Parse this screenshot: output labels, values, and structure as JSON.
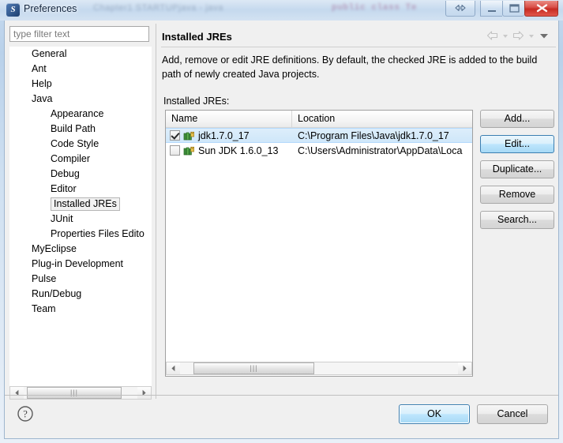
{
  "window": {
    "title": "Preferences",
    "app_icon": "eclipse-icon",
    "ghost_text_left": "Chapter1  STARTUPjava  -  java",
    "ghost_text_right": "public class  Te",
    "controls": {
      "resize": "resize-restore",
      "minimize": "minimize",
      "maximize": "maximize",
      "close": "close"
    }
  },
  "sidebar": {
    "filter": {
      "placeholder": "type filter text",
      "value": ""
    },
    "items": [
      {
        "label": "General",
        "level": 1,
        "selected": false
      },
      {
        "label": "Ant",
        "level": 1,
        "selected": false
      },
      {
        "label": "Help",
        "level": 1,
        "selected": false
      },
      {
        "label": "Java",
        "level": 1,
        "selected": false
      },
      {
        "label": "Appearance",
        "level": 2,
        "selected": false
      },
      {
        "label": "Build Path",
        "level": 2,
        "selected": false
      },
      {
        "label": "Code Style",
        "level": 2,
        "selected": false
      },
      {
        "label": "Compiler",
        "level": 2,
        "selected": false
      },
      {
        "label": "Debug",
        "level": 2,
        "selected": false
      },
      {
        "label": "Editor",
        "level": 2,
        "selected": false
      },
      {
        "label": "Installed JREs",
        "level": 2,
        "selected": true
      },
      {
        "label": "JUnit",
        "level": 2,
        "selected": false
      },
      {
        "label": "Properties Files Edito",
        "level": 2,
        "selected": false
      },
      {
        "label": "MyEclipse",
        "level": 1,
        "selected": false
      },
      {
        "label": "Plug-in Development",
        "level": 1,
        "selected": false
      },
      {
        "label": "Pulse",
        "level": 1,
        "selected": false
      },
      {
        "label": "Run/Debug",
        "level": 1,
        "selected": false
      },
      {
        "label": "Team",
        "level": 1,
        "selected": false
      }
    ],
    "scrollbar": {
      "left_arrow": "scroll-left-arrow",
      "right_arrow": "scroll-right-arrow",
      "grip": "|||"
    }
  },
  "page": {
    "title": "Installed JREs",
    "description": "Add, remove or edit JRE definitions. By default, the checked JRE is added to the build path of newly created Java projects.",
    "list_label": "Installed JREs:",
    "nav": {
      "back": "back-arrow-icon",
      "back_menu": "back-dropdown-icon",
      "forward": "forward-arrow-icon",
      "forward_menu": "forward-dropdown-icon",
      "menu": "view-menu-icon"
    }
  },
  "table": {
    "columns": [
      "Name",
      "Location"
    ],
    "rows": [
      {
        "checked": true,
        "icon": "jre-library-icon",
        "name": "jdk1.7.0_17",
        "location": "C:\\Program Files\\Java\\jdk1.7.0_17",
        "selected": true
      },
      {
        "checked": false,
        "icon": "jre-library-icon",
        "name": "Sun JDK 1.6.0_13",
        "location": "C:\\Users\\Administrator\\AppData\\Loca",
        "selected": false
      }
    ],
    "scrollbar": {
      "left_arrow": "scroll-left-arrow",
      "right_arrow": "scroll-right-arrow",
      "grip": "|||"
    }
  },
  "side_buttons": [
    {
      "label": "Add...",
      "hot": false
    },
    {
      "label": "Edit...",
      "hot": true
    },
    {
      "label": "Duplicate...",
      "hot": false
    },
    {
      "label": "Remove",
      "hot": false
    },
    {
      "label": "Search...",
      "hot": false
    }
  ],
  "footer": {
    "help": "help-icon",
    "ok": "OK",
    "cancel": "Cancel"
  },
  "colors": {
    "accent_blue": "#3c7fb1",
    "selection_blue": "#cfe7fa",
    "close_red": "#c62b22",
    "dialog_bg": "#f0f0f0"
  }
}
